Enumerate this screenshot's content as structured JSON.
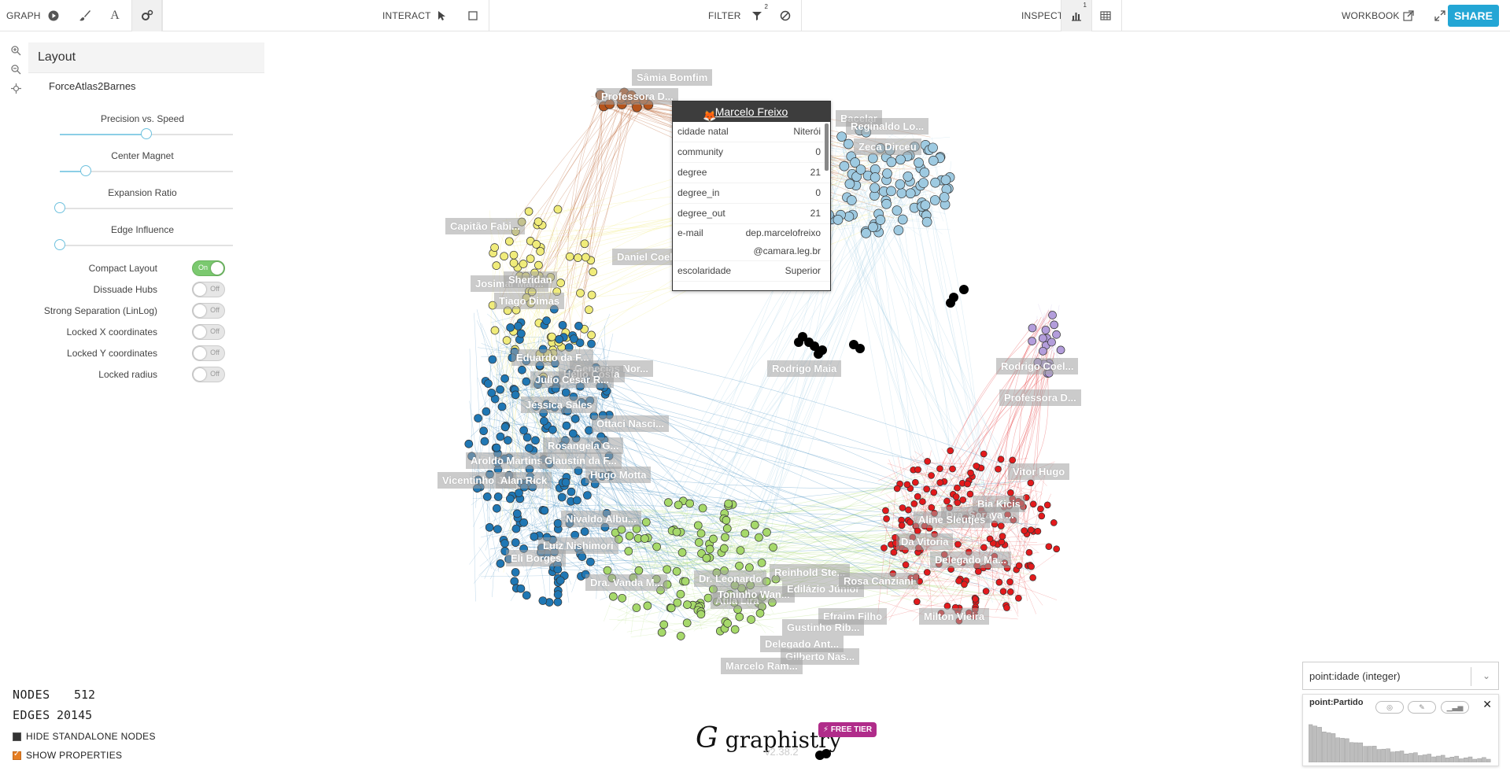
{
  "toolbar": {
    "graph_label": "GRAPH",
    "interact_label": "INTERACT",
    "filter_label": "FILTER",
    "filter_count": "2",
    "inspect_label": "INSPECT",
    "inspect_count": "1",
    "workbook_label": "WORKBOOK",
    "share_label": "SHARE"
  },
  "layout_panel": {
    "title": "Layout",
    "algorithm": "ForceAtlas2Barnes",
    "sliders": [
      {
        "label": "Precision vs. Speed",
        "value": 0.5
      },
      {
        "label": "Center Magnet",
        "value": 0.15
      },
      {
        "label": "Expansion Ratio",
        "value": 0.0
      },
      {
        "label": "Edge Influence",
        "value": 0.0
      }
    ],
    "toggles": [
      {
        "label": "Compact Layout",
        "state": "On"
      },
      {
        "label": "Dissuade Hubs",
        "state": "Off"
      },
      {
        "label": "Strong Separation (LinLog)",
        "state": "Off"
      },
      {
        "label": "Locked X coordinates",
        "state": "Off"
      },
      {
        "label": "Locked Y coordinates",
        "state": "Off"
      },
      {
        "label": "Locked radius",
        "state": "Off"
      }
    ]
  },
  "tooltip": {
    "title": "Marcelo Freixo",
    "rows": [
      {
        "key": "cidade natal",
        "value": "Niterói"
      },
      {
        "key": "community",
        "value": "0"
      },
      {
        "key": "degree",
        "value": "21"
      },
      {
        "key": "degree_in",
        "value": "0"
      },
      {
        "key": "degree_out",
        "value": "21"
      },
      {
        "key": "e-mail",
        "value": "dep.marcelofreixo@camara.leg.br"
      },
      {
        "key": "escolaridade",
        "value": "Superior"
      }
    ]
  },
  "labels": [
    "Sâmia Bomfim",
    "Professora D...",
    "Bacelar",
    "Reginaldo Lo...",
    "Zeca Dirceu",
    "Capitão Fabi...",
    "Daniel Coelho",
    "Josimar Mar...",
    "Sheridan",
    "Tiago Dimas",
    "Eduardo da F...",
    "Genecias Nor...",
    "Hélio Costa",
    "Julio César R...",
    "Jéssica Sales",
    "Ottaci Nasci...",
    "Rosangela G...",
    "Aroldo Martins",
    "Glaustin da F...",
    "Vicentinho J...",
    "Alan Rick",
    "Hugo Motta",
    "Nivaldo Albu...",
    "Luiz Nishimori",
    "Eli Borges",
    "Dra. Vanda M...",
    "Dr. Leonardo",
    "Átila Lira",
    "Toninho Wan...",
    "Reinhold Ste...",
    "Edilázio Júnior",
    "Rosa Canziani",
    "Efraim Filho",
    "Gustinho Rib...",
    "Delegado Ant...",
    "Gilberto Nas...",
    "Marcelo Ram...",
    "Milton Vieira",
    "Rodrigo Maia",
    "Rodrigo Coel...",
    "Professora D...",
    "Vitor Hugo",
    "Bia Kicis",
    "Dra. Soraya ...",
    "Aline Sleutjes",
    "Da Vitoria",
    "Delegado Ma..."
  ],
  "stats": {
    "nodes_label": "NODES",
    "nodes_value": "512",
    "edges_label": "EDGES",
    "edges_value": "20145",
    "hide_standalone": "HIDE STANDALONE NODES",
    "show_properties": "SHOW PROPERTIES"
  },
  "branding": {
    "logo_text": "graphistry",
    "tier": "FREE TIER",
    "version": "v2.38.2"
  },
  "histogram": {
    "selected": "point:idade (integer)",
    "title": "point:Partido"
  },
  "colors": {
    "accent": "#23a6d5",
    "community_blue_dark": "#1f77b4",
    "community_blue_light": "#9ecae1",
    "community_green": "#a6d96a",
    "community_red": "#e31a1c",
    "community_yellow": "#f0ec7a",
    "community_orange": "#b5541c",
    "community_purple": "#b39ddb"
  },
  "icons": {
    "play": "play-icon",
    "brush": "brush-icon",
    "text": "text-icon",
    "settings": "gears-icon",
    "pointer": "pointer-icon",
    "select-box": "select-box-icon",
    "filter": "filter-icon",
    "no-filter": "ban-icon",
    "histogram": "bar-chart-icon",
    "table": "table-icon",
    "external-link": "external-link-icon",
    "fullscreen": "expand-icon"
  }
}
